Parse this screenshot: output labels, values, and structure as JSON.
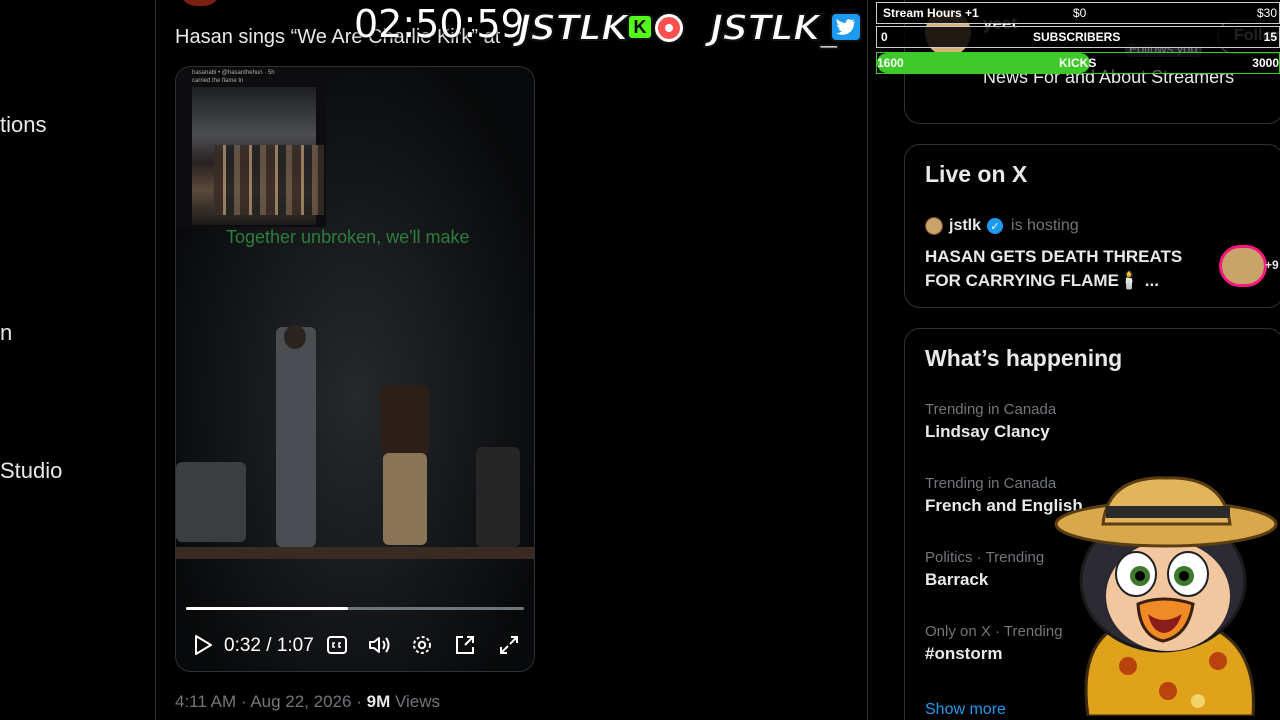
{
  "left_nav": {
    "items": [
      "tions",
      "n",
      "Studio"
    ]
  },
  "tweet": {
    "author_handle_partial": "",
    "text": "Hasan sings “We Are Charlie Kirk” at",
    "time": "4:11 AM",
    "date": "Aug 22, 2026",
    "separator": "·",
    "views_count": "9M",
    "views_label": "Views"
  },
  "video": {
    "inset_handle": "hasanabi • @hasanthehun · 5h",
    "inset_caption": "carried the flame tn",
    "lyrics": "Together unbroken, we'll make",
    "current_time": "0:32",
    "time_separator": "/",
    "duration": "1:07",
    "progress_fraction": 0.48,
    "icons": [
      "play-icon",
      "closed-captions-icon",
      "volume-icon",
      "settings-icon",
      "pip-icon",
      "fullscreen-icon"
    ]
  },
  "sidebar": {
    "profile_card": {
      "name": "yeet",
      "follows_you": "Follows you",
      "follow_button": "Followin",
      "tagline": "News For and About Streamers"
    },
    "live": {
      "title": "Live on X",
      "host": "jstlk",
      "status": "is hosting",
      "space_title": "HASAN GETS DEATH THREATS FOR CARRYING FLAME🕯️ ...",
      "listener_suffix": "+9"
    },
    "happening": {
      "title": "What’s happening",
      "trends": [
        {
          "context": "Trending in Canada",
          "name": "Lindsay Clancy"
        },
        {
          "context": "Trending in Canada",
          "name": "French and English"
        },
        {
          "context": "Politics · Trending",
          "name": "Barrack"
        },
        {
          "context": "Only on X · Trending",
          "name": "#onstorm"
        }
      ],
      "show_more": "Show more"
    }
  },
  "overlay": {
    "clock": "02:50:59",
    "brand_left": "JSTLK",
    "kick_letter": "K",
    "brand_right": "JSTLK_",
    "goals": [
      {
        "label": "Stream Hours +1",
        "start": "$0",
        "end": "$30"
      },
      {
        "label": "SUBSCRIBERS",
        "start": "0",
        "end": "15"
      },
      {
        "label": "KICKS",
        "start": "1600",
        "end": "3000",
        "progress_fraction": 0.53
      }
    ]
  },
  "colors": {
    "accent_blue": "#1d9bf0",
    "kick_green": "#53fc18",
    "goal_green": "#3ecb2a",
    "live_ring": "#f91880",
    "muted_text": "#71767b"
  }
}
